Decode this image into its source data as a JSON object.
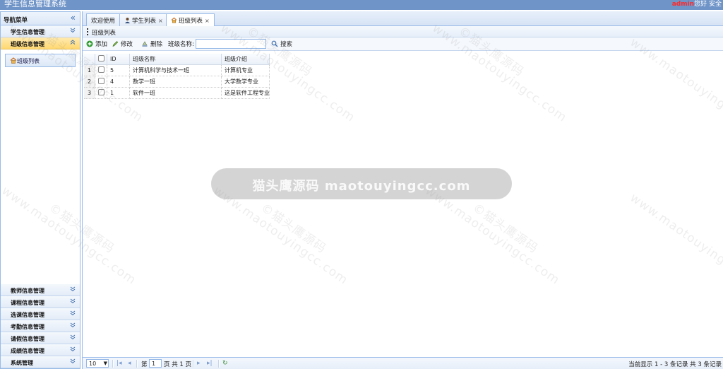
{
  "header": {
    "app_title": "学生信息管理系统",
    "username": "admin",
    "greeting": "您好",
    "extra": "安全"
  },
  "sidebar": {
    "title": "导航菜单",
    "groups": [
      {
        "label": "学生信息管理",
        "expanded": false
      },
      {
        "label": "班级信息管理",
        "expanded": true
      }
    ],
    "active_sub_item": "班级列表",
    "bottom_groups": [
      {
        "label": "教师信息管理"
      },
      {
        "label": "课程信息管理"
      },
      {
        "label": "选课信息管理"
      },
      {
        "label": "考勤信息管理"
      },
      {
        "label": "请假信息管理"
      },
      {
        "label": "成绩信息管理"
      },
      {
        "label": "系统管理"
      }
    ]
  },
  "tabs": [
    {
      "label": "欢迎使用",
      "closable": false
    },
    {
      "label": "学生列表",
      "closable": true
    },
    {
      "label": "班级列表",
      "closable": true,
      "active": true
    }
  ],
  "panel": {
    "title": "班级列表"
  },
  "toolbar": {
    "add": "添加",
    "edit": "修改",
    "delete": "删除",
    "search_label": "班级名称:",
    "search_value": "",
    "search_button": "搜索"
  },
  "grid": {
    "columns": [
      "ID",
      "班级名称",
      "班级介绍"
    ],
    "rows": [
      {
        "num": "1",
        "id": "5",
        "name": "计算机科学与技术一班",
        "intro": "计算机专业"
      },
      {
        "num": "2",
        "id": "4",
        "name": "数学一班",
        "intro": "大学数学专业"
      },
      {
        "num": "3",
        "id": "1",
        "name": "软件一班",
        "intro": "这是软件工程专业"
      }
    ]
  },
  "pager": {
    "page_size": "10",
    "page_prefix": "第",
    "page_value": "1",
    "page_suffix": "页 共 1 页",
    "info": "当前显示 1 - 3 条记录 共 3 条记录"
  },
  "watermark": {
    "text": "www.maotouyingcc.com",
    "mark": "©猫头鹰源码",
    "banner": "猫头鹰源码 maotouyingcc.com"
  },
  "colors": {
    "header": "#6f94c8",
    "border": "#99bbe8",
    "active_group": "#ffd870",
    "username": "#ff2a2a"
  }
}
